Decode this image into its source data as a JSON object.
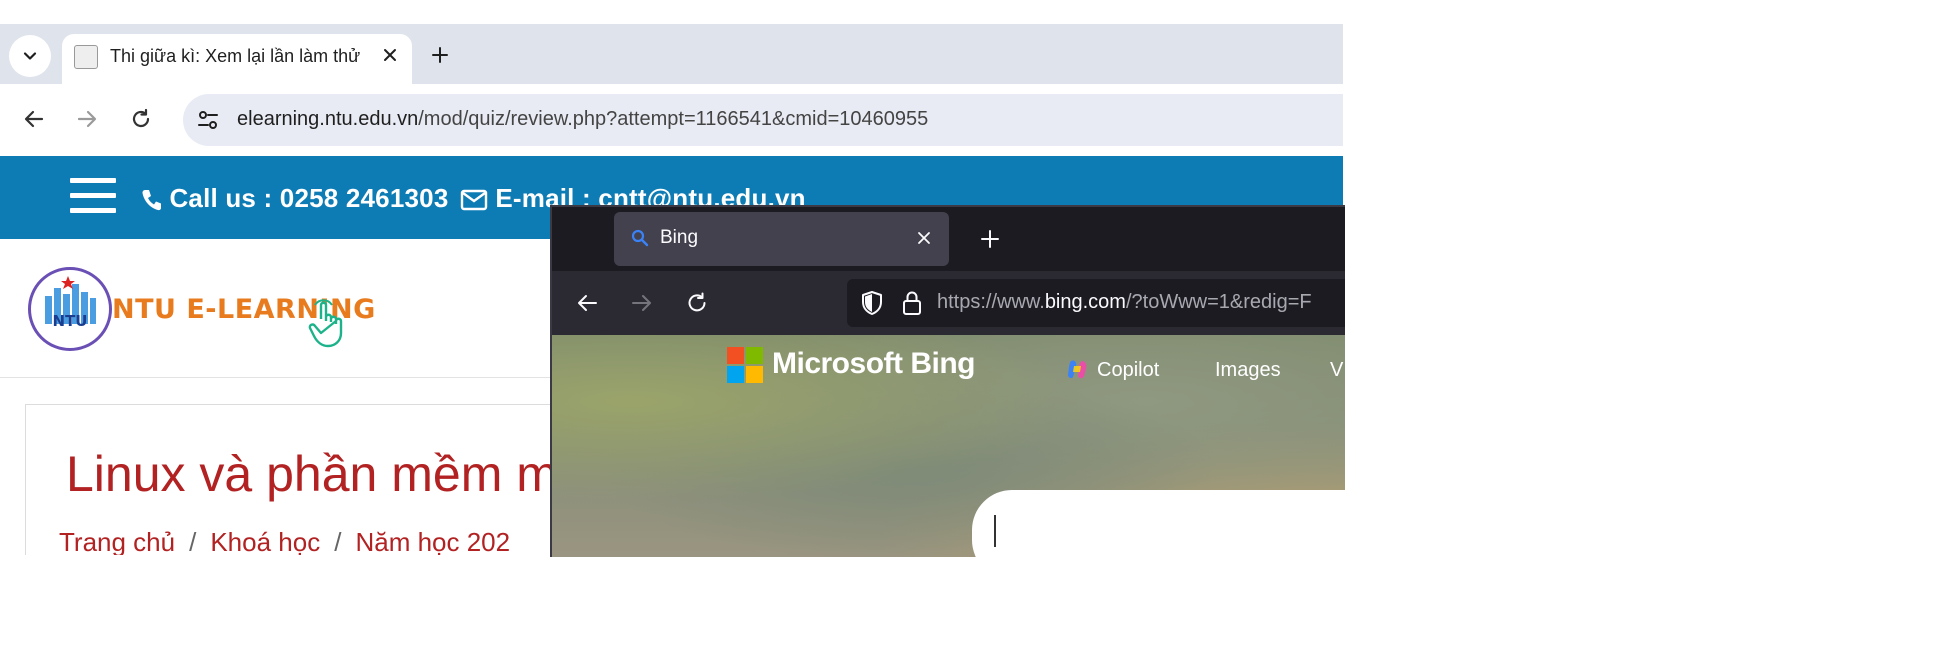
{
  "chrome": {
    "tab": {
      "title": "Thi giữa kì: Xem lại lần làm thử"
    },
    "address": {
      "host": "elearning.ntu.edu.vn",
      "path": "/mod/quiz/review.php?attempt=1166541&cmid=10460955"
    },
    "site": {
      "contact_phone": "Call us : 0258 2461303",
      "contact_email": "E-mail : cntt@ntu.edu.vn",
      "logo_text": "NTU E-LEARNING",
      "logo_badge": "NTU",
      "course_title": "Linux và phần mềm m",
      "breadcrumb": [
        "Trang chủ",
        "Khoá học",
        "Năm học 202"
      ]
    }
  },
  "firefox": {
    "tab": {
      "title": "Bing"
    },
    "address": {
      "prefix": "https://www.",
      "host": "bing.com",
      "rest": "/?toWww=1&redig=F"
    },
    "bing": {
      "brand": "Microsoft Bing",
      "nav": [
        "Copilot",
        "Images",
        "V"
      ]
    }
  },
  "colors": {
    "ntu_blue": "#0e7cb4",
    "ntu_orange": "#e87b1e",
    "course_red": "#b22222",
    "ms_red": "#f25022",
    "ms_green": "#7fba00",
    "ms_blue": "#00a4ef",
    "ms_yellow": "#ffb900"
  }
}
